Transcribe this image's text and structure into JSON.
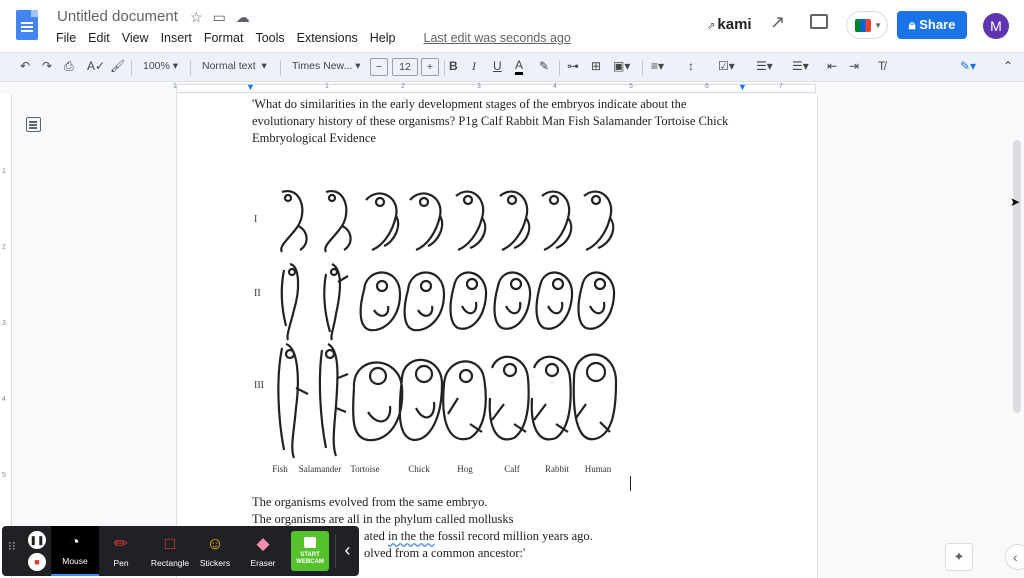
{
  "app": {
    "doc_title": "Untitled document",
    "menus": [
      "File",
      "Edit",
      "View",
      "Insert",
      "Format",
      "Tools",
      "Extensions",
      "Help"
    ],
    "last_edit": "Last edit was seconds ago",
    "kami_label": "kami",
    "share_label": "Share",
    "avatar_initial": "M"
  },
  "toolbar": {
    "zoom": "100%",
    "style": "Normal text",
    "font": "Times New...",
    "font_size": "12",
    "minus": "−",
    "plus": "+"
  },
  "ruler": {
    "h_ticks": [
      "1",
      "1",
      "2",
      "3",
      "4",
      "5",
      "6",
      "7"
    ],
    "v_ticks": [
      "1",
      "2",
      "3",
      "4",
      "5"
    ]
  },
  "document": {
    "question": "'What do similarities in the early development stages of the embryos indicate about the evolutionary history of these organisms?  P1g Calf Rabbit Man Fish Salamander Tortoise Chick Embryological Evidence",
    "answer_1": "The organisms evolved from the same embryo.",
    "answer_2": "The organisms are all in the phylum called mollusks",
    "answer_3_a": "ated ",
    "answer_3_b": "in the the",
    "answer_3_c": " fossil record million years ago.",
    "answer_4": "olved from a common ancestor:'"
  },
  "figure": {
    "row_labels": [
      "I",
      "II",
      "III"
    ],
    "organisms": [
      "Fish",
      "Salamander",
      "Tortoise",
      "Chick",
      "Hog",
      "Calf",
      "Rabbit",
      "Human"
    ]
  },
  "kami_toolbar": {
    "tools": [
      "Mouse",
      "Pen",
      "Rectangle",
      "Stickers",
      "Eraser"
    ],
    "webcam_line1": "START",
    "webcam_line2": "WEBCAM",
    "active_tool": "Mouse"
  },
  "colors": {
    "accent": "#1a73e8",
    "kami_bar": "#202124",
    "webcam": "#55c12c",
    "pen": "#e53935"
  }
}
